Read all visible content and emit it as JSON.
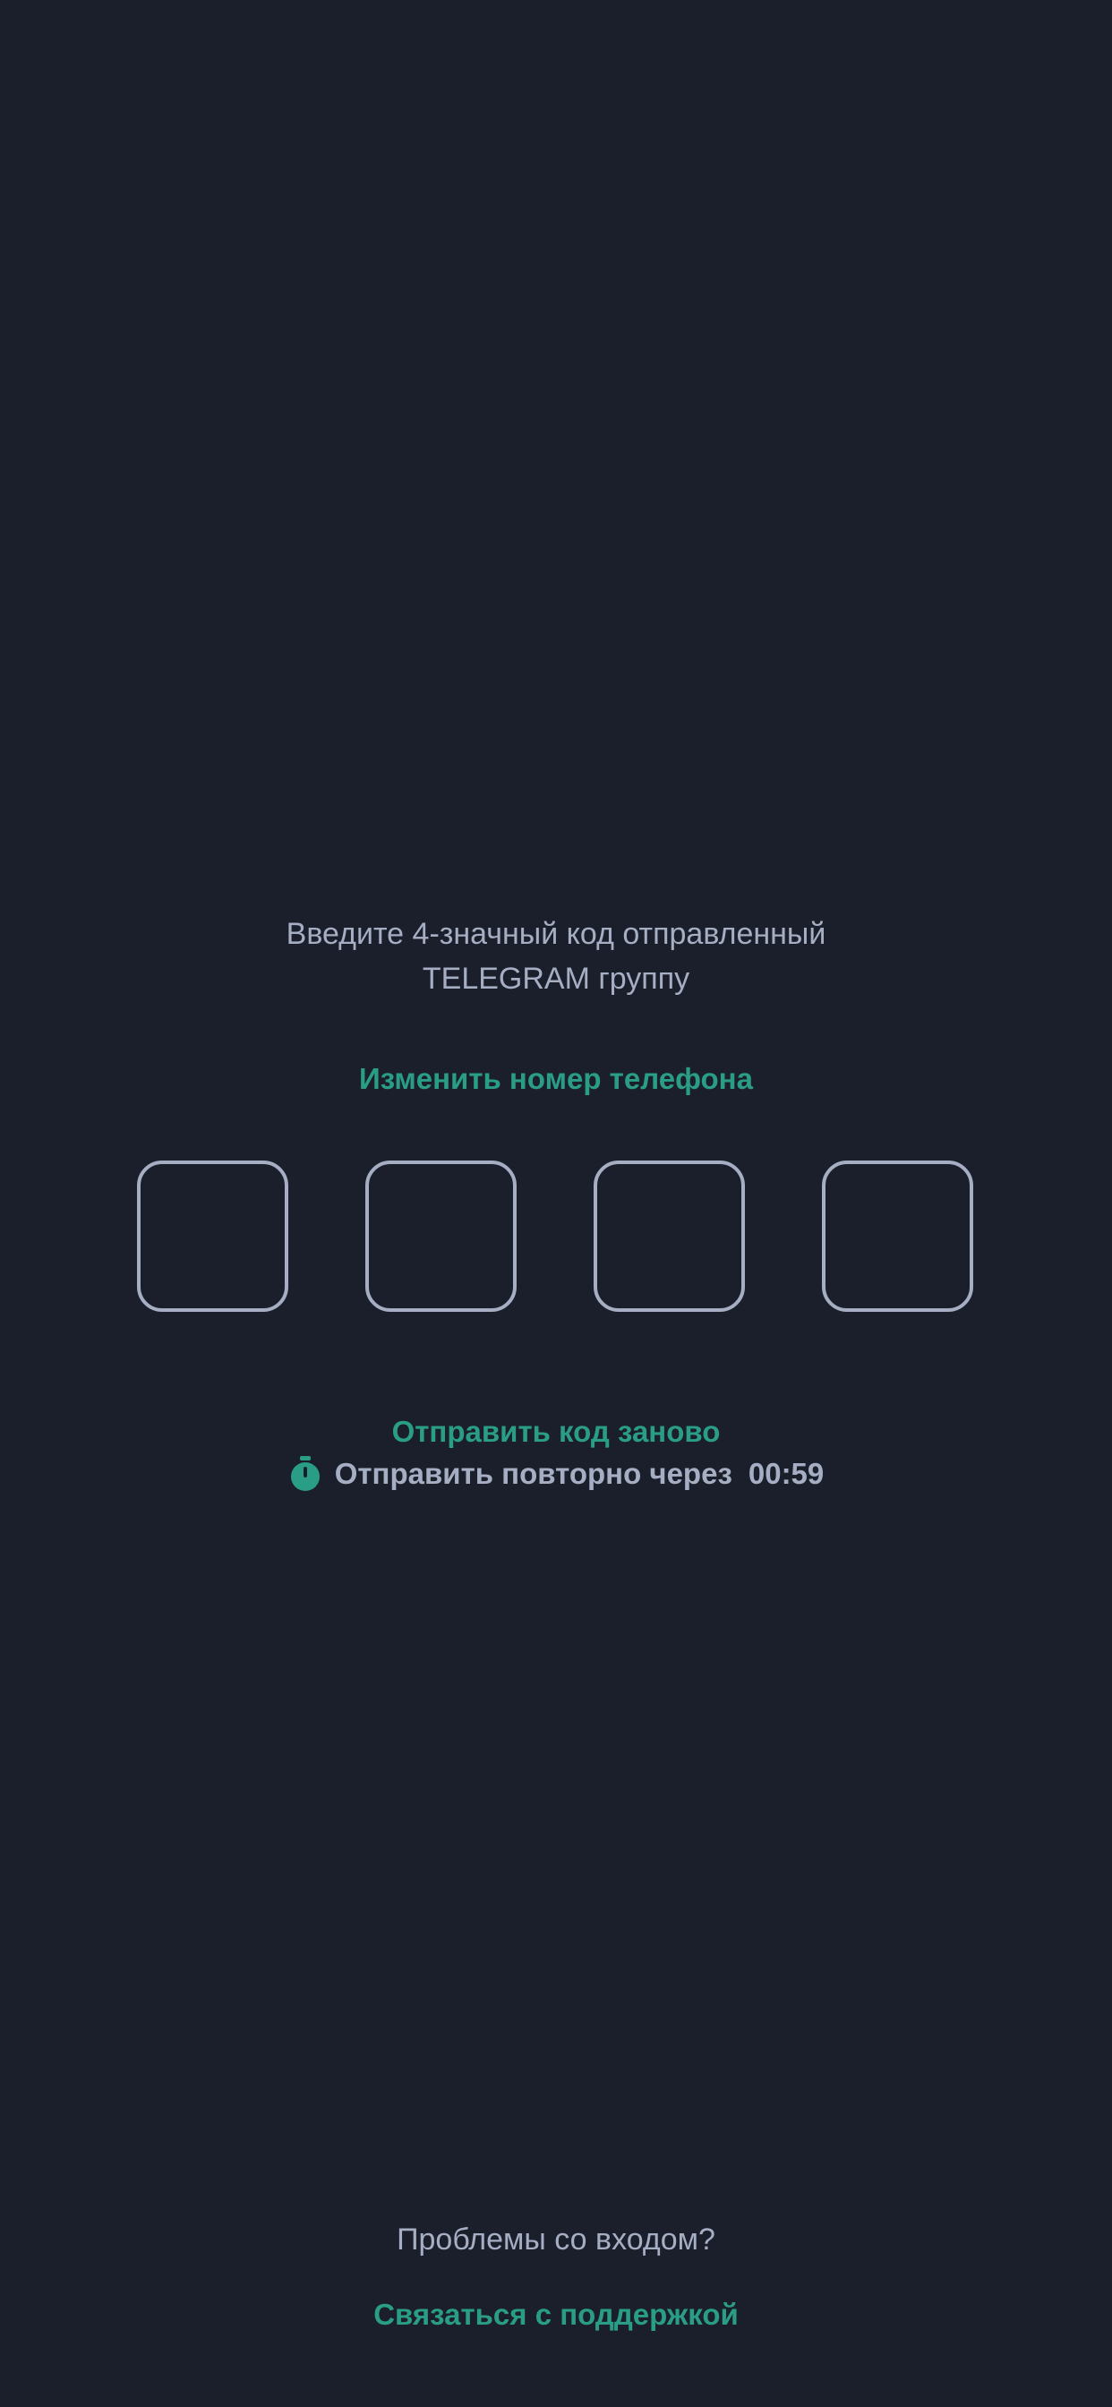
{
  "instruction": {
    "line1": "Введите 4-значный код отправленный",
    "line2": "TELEGRAM группу"
  },
  "change_phone_label": "Изменить номер телефона",
  "code_input": {
    "digits": [
      "",
      "",
      "",
      ""
    ]
  },
  "resend_label": "Отправить код заново",
  "timer": {
    "icon": "stopwatch-icon",
    "label": "Отправить повторно через",
    "value": "00:59"
  },
  "footer": {
    "problems_text": "Проблемы со входом?",
    "support_label": "Связаться с поддержкой"
  },
  "colors": {
    "background": "#1b1f2b",
    "accent": "#2a9d86",
    "text": "#a5aec2"
  }
}
